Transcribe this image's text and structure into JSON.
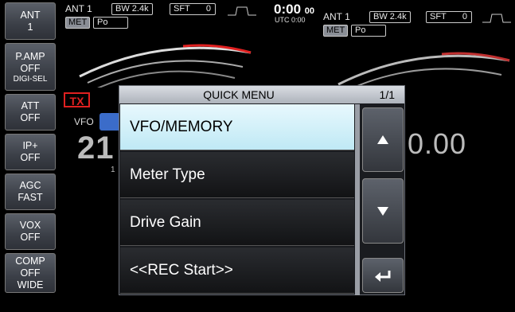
{
  "sidebar": {
    "buttons": [
      {
        "line1": "ANT",
        "line2": "1"
      },
      {
        "line1": "P.AMP",
        "line2": "OFF",
        "line3": "DIGI-SEL"
      },
      {
        "line1": "ATT",
        "line2": "OFF"
      },
      {
        "line1": "IP+",
        "line2": "OFF"
      },
      {
        "line1": "AGC",
        "line2": "FAST"
      },
      {
        "line1": "VOX",
        "line2": "OFF"
      },
      {
        "line1": "COMP",
        "line2": "OFF",
        "line3": "WIDE"
      }
    ]
  },
  "main_left": {
    "ant": "ANT 1",
    "bw": "BW 2.4k",
    "sft_label": "SFT",
    "sft_value": "0",
    "met": "MET",
    "met_mode": "Po"
  },
  "main_right": {
    "ant": "ANT 1",
    "bw": "BW 2.4k",
    "sft_label": "SFT",
    "sft_value": "0",
    "met": "MET",
    "met_mode": "Po"
  },
  "clock": {
    "time": "0:00",
    "seconds": "00",
    "utc": "UTC  0:00"
  },
  "tx_badge": "TX",
  "vfo_label": "VFO",
  "freq_left": "21",
  "freq_right": "0.00",
  "freq_small": "1",
  "quick_menu": {
    "title": "QUICK MENU",
    "page": "1/1",
    "items": [
      "VFO/MEMORY",
      "Meter Type",
      "Drive Gain",
      "<<REC Start>>"
    ]
  },
  "colors": {
    "accent_selected": "#bfe9f5",
    "tx_red": "#e02020",
    "vfo_blue": "#3b6cc9"
  }
}
